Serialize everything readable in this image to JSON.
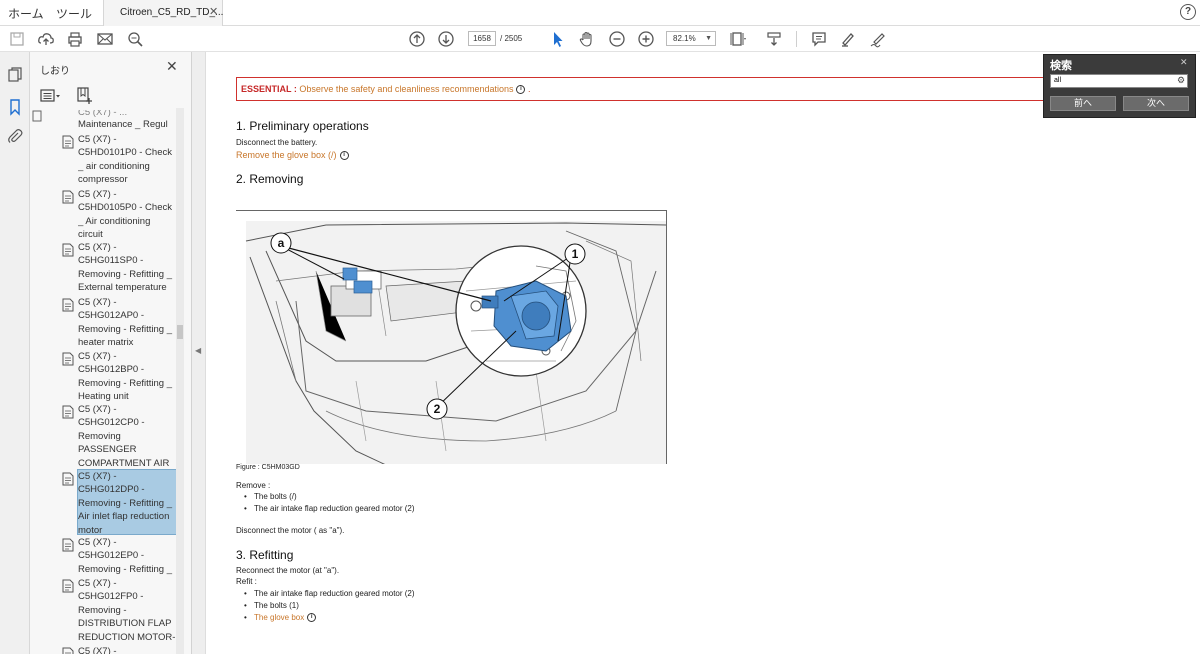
{
  "menu": {
    "items": [
      "ホーム",
      "ツール"
    ],
    "tab_label": "Citroen_C5_RD_TD_...",
    "help": "?"
  },
  "toolbar": {
    "current_page": "1658",
    "page_total": "/ 2505",
    "zoom": "82.1%"
  },
  "sidebar": {
    "title": "しおり",
    "items": [
      {
        "label": "Maintenance _ Regul",
        "partial_top": "C5 (X7) - ..."
      },
      {
        "label": "C5 (X7) - C5HD0101P0 - Check _ air conditioning compressor"
      },
      {
        "label": "C5 (X7) - C5HD0105P0 - Check _ Air conditioning circuit"
      },
      {
        "label": "C5 (X7) - C5HG011SP0 - Removing - Refitting _ External temperature sensor"
      },
      {
        "label": "C5 (X7) - C5HG012AP0 - Removing - Refitting _ heater matrix"
      },
      {
        "label": "C5 (X7) - C5HG012BP0 - Removing - Refitting _ Heating unit"
      },
      {
        "label": "C5 (X7) - C5HG012CP0 - Removing PASSENGER COMPARTMENT AIR"
      },
      {
        "label": "C5 (X7) - C5HG012DP0 - Removing - Refitting _ Air inlet flap reduction motor"
      },
      {
        "label": "C5 (X7) - C5HG012EP0 - Removing - Refitting _ Refrigerant hose"
      },
      {
        "label": "C5 (X7) - C5HG012FP0 - Removing - DISTRIBUTION FLAP REDUCTION MOTOR-MIXING FLAP"
      },
      {
        "label": "C5 (X7) -"
      }
    ]
  },
  "document": {
    "essential_label": "ESSENTIAL :",
    "essential_text": "Observe the safety and cleanliness recommendations",
    "essential_tail": ".",
    "section1_title": "1. Preliminary operations",
    "section1_line1": "Disconnect the battery.",
    "section1_link": "Remove the glove box (/)",
    "section2_title": "2. Removing",
    "figure_caption": "Figure : C5HM03GD",
    "remove_label": "Remove :",
    "remove_items": [
      "The bolts (/)",
      "The air intake flap reduction geared motor (2)"
    ],
    "disconnect_line": "Disconnect the motor ( as \"a\").",
    "section3_title": "3. Refitting",
    "reconnect_line": "Reconnect the motor (at \"a\").",
    "refit_label": "Refit :",
    "refit_items": [
      "The air intake flap reduction geared motor (2)",
      "The bolts (1)"
    ],
    "refit_link": "The glove box",
    "figure_labels": {
      "a": "a",
      "one": "1",
      "two": "2"
    }
  },
  "find": {
    "title": "検索",
    "query": "all",
    "prev": "前へ",
    "next": "次へ"
  },
  "colors": {
    "essential_border": "#d0312d",
    "link": "#c8762a",
    "selection": "#a9cbe3",
    "part_highlight": "#4f8fd0"
  }
}
